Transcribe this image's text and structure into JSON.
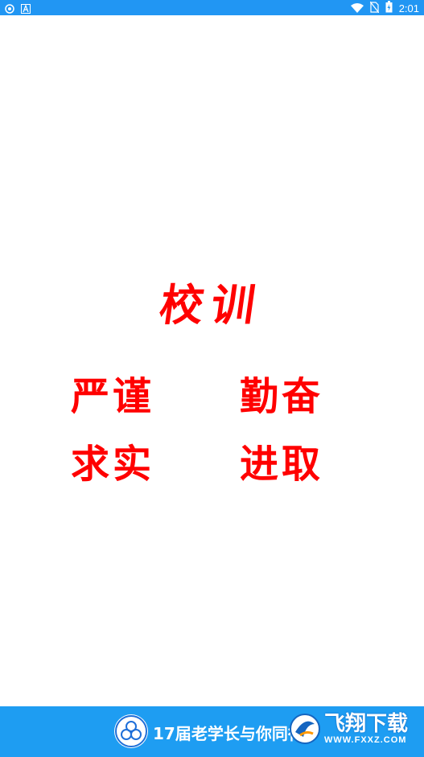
{
  "status_bar": {
    "icons_left": [
      "shield-icon",
      "a-icon"
    ],
    "icons_right": [
      "wifi-icon",
      "no-sim-icon",
      "battery-icon"
    ],
    "time": "2:01"
  },
  "motto": {
    "title": "校训",
    "line1_left": "严谨",
    "line1_right": "勤奋",
    "line2_left": "求实",
    "line2_right": "进取",
    "color": "#ff0000"
  },
  "banner": {
    "text": "17届老学长与你同行",
    "background": "#1e9df2"
  },
  "watermark": {
    "cn": "飞翔下载",
    "url": "WWW.FXXZ.COM"
  }
}
